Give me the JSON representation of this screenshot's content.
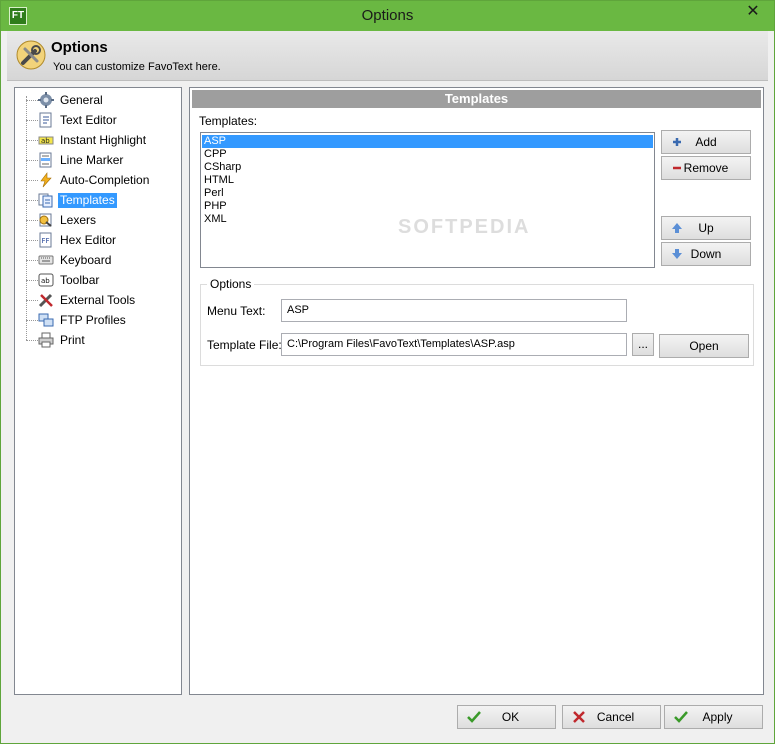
{
  "window": {
    "app_icon_text": "FT",
    "title": "Options",
    "close_glyph": "✕"
  },
  "header": {
    "title": "Options",
    "subtitle": "You can customize FavoText here."
  },
  "tree": {
    "items": [
      {
        "label": "General",
        "icon": "gear-icon",
        "selected": false
      },
      {
        "label": "Text Editor",
        "icon": "document-icon",
        "selected": false
      },
      {
        "label": "Instant Highlight",
        "icon": "highlight-icon",
        "selected": false
      },
      {
        "label": "Line Marker",
        "icon": "line-marker-icon",
        "selected": false
      },
      {
        "label": "Auto-Completion",
        "icon": "lightning-icon",
        "selected": false
      },
      {
        "label": "Templates",
        "icon": "templates-icon",
        "selected": true
      },
      {
        "label": "Lexers",
        "icon": "lexers-icon",
        "selected": false
      },
      {
        "label": "Hex Editor",
        "icon": "hex-icon",
        "selected": false
      },
      {
        "label": "Keyboard",
        "icon": "keyboard-icon",
        "selected": false
      },
      {
        "label": "Toolbar",
        "icon": "toolbar-icon",
        "selected": false
      },
      {
        "label": "External Tools",
        "icon": "tools-icon",
        "selected": false
      },
      {
        "label": "FTP Profiles",
        "icon": "ftp-icon",
        "selected": false
      },
      {
        "label": "Print",
        "icon": "printer-icon",
        "selected": false
      }
    ]
  },
  "panel": {
    "title": "Templates",
    "templates_label": "Templates:",
    "templates": [
      "ASP",
      "CPP",
      "CSharp",
      "HTML",
      "Perl",
      "PHP",
      "XML"
    ],
    "selected_template": "ASP",
    "add_label": "Add",
    "remove_label": "Remove",
    "up_label": "Up",
    "down_label": "Down",
    "options_legend": "Options",
    "menu_text_label": "Menu Text:",
    "menu_text_value": "ASP",
    "template_file_label": "Template File:",
    "template_file_value": "C:\\Program Files\\FavoText\\Templates\\ASP.asp",
    "browse_label": "...",
    "open_label": "Open",
    "watermark": "SOFTPEDIA"
  },
  "footer": {
    "ok_label": "OK",
    "cancel_label": "Cancel",
    "apply_label": "Apply"
  },
  "colors": {
    "titlebar": "#6ab842",
    "selection": "#3399ff",
    "panel_header": "#9e9e9e",
    "ok_check": "#3a9a2a",
    "cancel_x": "#c0282d"
  }
}
